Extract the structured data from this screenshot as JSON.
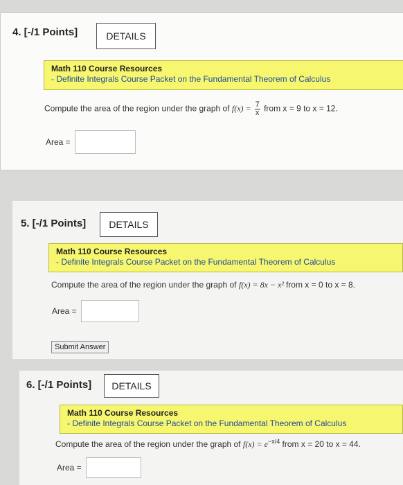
{
  "questions": [
    {
      "number": "4. [-/1 Points]",
      "details": "DETAILS",
      "resource_title": "Math 110 Course Resources",
      "resource_link": "- Definite Integrals Course Packet on the Fundamental Theorem of Calculus",
      "prompt_pre": "Compute the area of the region under the graph of ",
      "fx": "f(x) = ",
      "frac_num": "7",
      "frac_den": "x",
      "prompt_post": " from x = 9 to x = 12.",
      "area_label": "Area ="
    },
    {
      "number": "5. [-/1 Points]",
      "details": "DETAILS",
      "resource_title": "Math 110 Course Resources",
      "resource_link": "- Definite Integrals Course Packet on the Fundamental Theorem of Calculus",
      "prompt_pre": "Compute the area of the region under the graph of ",
      "fx": "f(x) = 8x − x² ",
      "prompt_post": "from x = 0 to x = 8.",
      "area_label": "Area =",
      "submit": "Submit Answer"
    },
    {
      "number": "6. [-/1 Points]",
      "details": "DETAILS",
      "resource_title": "Math 110 Course Resources",
      "resource_link": "- Definite Integrals Course Packet on the Fundamental Theorem of Calculus",
      "prompt_pre": "Compute the area of the region under the graph of ",
      "fx": "f(x) = e",
      "exp": "−x/4",
      "prompt_post": " from x = 20 to x = 44.",
      "area_label": "Area ="
    }
  ]
}
